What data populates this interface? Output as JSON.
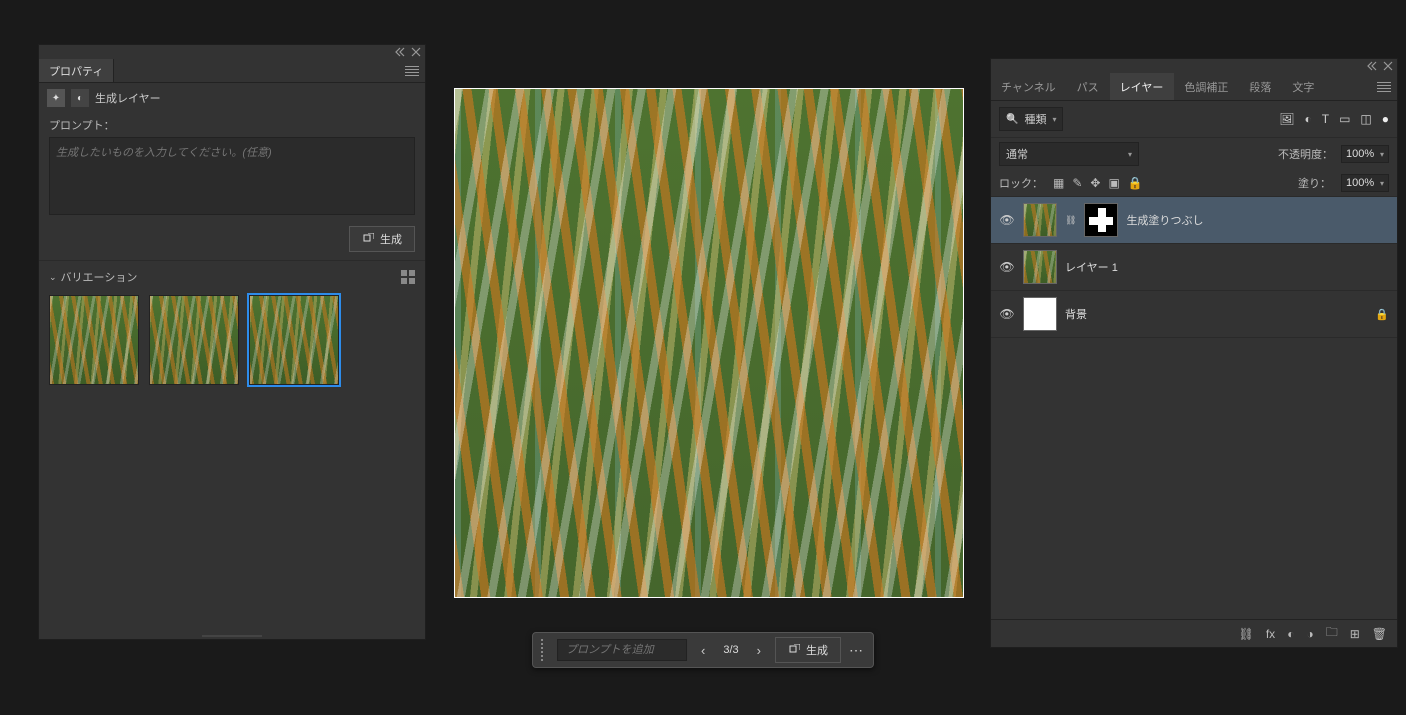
{
  "properties": {
    "tab_label": "プロパティ",
    "section_label": "生成レイヤー",
    "prompt_label": "プロンプト：",
    "prompt_placeholder": "生成したいものを入力してください。(任意)",
    "generate_button": "生成",
    "variations_label": "バリエーション",
    "selected_variation_index": 2
  },
  "context_bar": {
    "prompt_placeholder": "プロンプトを追加",
    "nav": "3/3",
    "generate_button": "生成"
  },
  "right_panel": {
    "tabs": {
      "channels": "チャンネル",
      "paths": "パス",
      "layers": "レイヤー",
      "adjustments": "色調補正",
      "paragraph": "段落",
      "character": "文字"
    },
    "filter_dropdown": "種類",
    "blend_mode": "通常",
    "opacity_label": "不透明度：",
    "opacity_value": "100%",
    "lock_label": "ロック：",
    "fill_label": "塗り：",
    "fill_value": "100%",
    "layers": [
      {
        "name": "生成塗りつぶし",
        "kind": "genfill",
        "selected": true,
        "locked": false
      },
      {
        "name": "レイヤー 1",
        "kind": "image",
        "selected": false,
        "locked": false
      },
      {
        "name": "背景",
        "kind": "white",
        "selected": false,
        "locked": true
      }
    ]
  }
}
